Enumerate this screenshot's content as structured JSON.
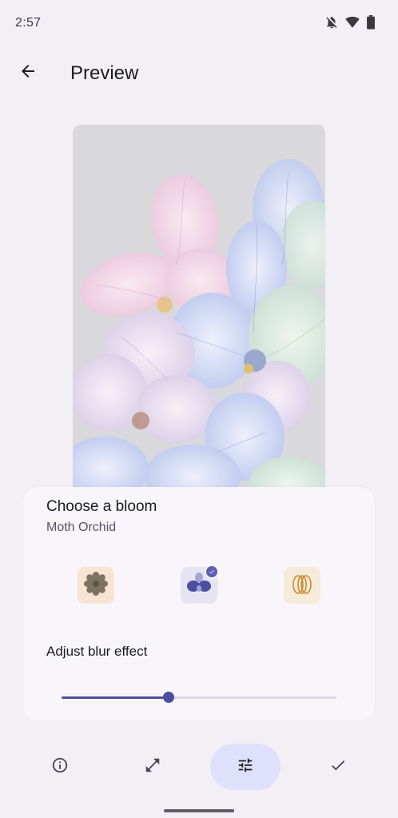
{
  "status_bar": {
    "time": "2:57",
    "icons": [
      "notifications-off-icon",
      "wifi-icon",
      "battery-icon"
    ]
  },
  "app_bar": {
    "back_icon": "arrow-left-icon",
    "title": "Preview"
  },
  "preview": {
    "image": "orchid-flowers-wallpaper"
  },
  "bloom_sheet": {
    "title": "Choose a bloom",
    "selected_name": "Moth Orchid",
    "options": [
      {
        "icon": "flower-icon",
        "selected": false
      },
      {
        "icon": "moth-orchid-icon",
        "selected": true
      },
      {
        "icon": "tulip-icon",
        "selected": false
      }
    ],
    "blur_label": "Adjust blur effect",
    "blur_value": 0.39
  },
  "bottom_bar": {
    "items": [
      "info-icon",
      "expand-icon",
      "tune-icon",
      "check-icon"
    ],
    "active": "tune-icon"
  },
  "colors": {
    "accent": "#4b4fa0",
    "active_pill": "#dfe0fb",
    "background": "#f2eff5"
  }
}
